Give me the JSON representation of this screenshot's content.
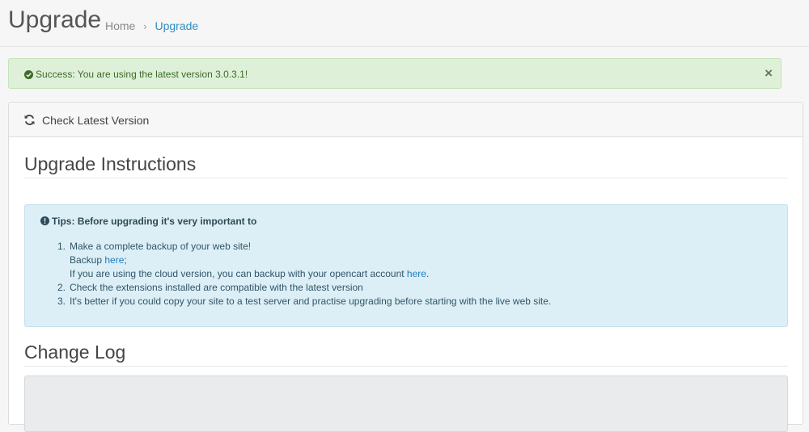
{
  "header": {
    "title": "Upgrade",
    "breadcrumb": {
      "home": "Home",
      "separator": "›",
      "current": "Upgrade"
    }
  },
  "success_alert": {
    "text": "Success: You are using the latest version 3.0.3.1!",
    "close": "×"
  },
  "panel": {
    "heading": "Check Latest Version",
    "instructions_title": "Upgrade Instructions",
    "tips": {
      "title": "Tips: Before upgrading it's very important to",
      "items": [
        {
          "num": "1.",
          "text": "Make a complete backup of your web site!"
        },
        {
          "backup_prefix": "Backup ",
          "backup_link": "here",
          "backup_suffix": ";"
        },
        {
          "cloud_prefix": "If you are using the cloud version, you can backup with your opencart account ",
          "cloud_link": "here",
          "cloud_suffix": "."
        },
        {
          "num": "2.",
          "text": "Check the extensions installed are compatible with the latest version"
        },
        {
          "num": "3.",
          "text": "It's better if you could copy your site to a test server and practise upgrading before starting with the live web site."
        }
      ]
    },
    "changelog_title": "Change Log"
  },
  "colors": {
    "success_bg": "#dff0d8",
    "info_bg": "#ddeff6",
    "link": "#1c7bbf",
    "breadcrumb_active": "#2a8fc7"
  }
}
